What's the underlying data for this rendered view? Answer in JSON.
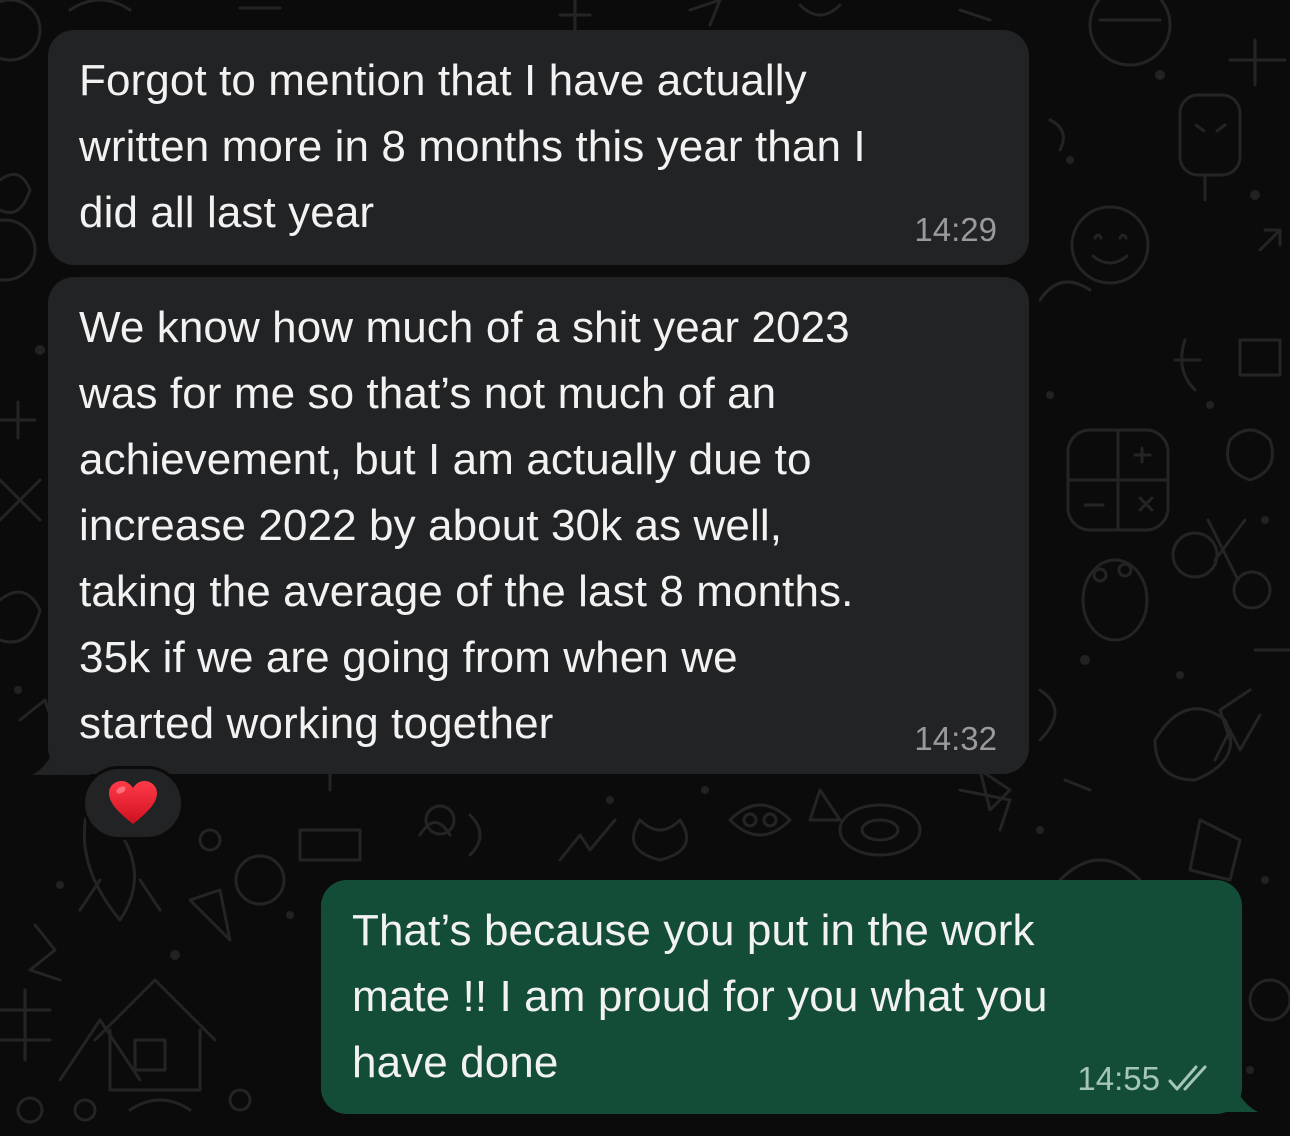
{
  "conversation": {
    "messages": [
      {
        "direction": "incoming",
        "text": "Forgot to mention that I have actually\nwritten more in 8 months this year than I\ndid all last year",
        "time": "14:29"
      },
      {
        "direction": "incoming",
        "text": "We know how much of a shit year 2023\nwas for me so that’s not much of an\nachievement, but I am actually due to\nincrease 2022 by about 30k as well,\ntaking the average of the last 8 months.\n35k if we are going from when we\nstarted working together",
        "time": "14:32",
        "reaction": "heart-emoji"
      },
      {
        "direction": "outgoing",
        "text": "That’s because you put in the work\nmate !! I am proud for you what you\nhave done",
        "time": "14:55",
        "status": "read-double-check"
      }
    ]
  },
  "colors": {
    "background": "#0b0b0b",
    "incoming_bubble": "#222325",
    "outgoing_bubble": "#144d37",
    "text": "#f2f2f2",
    "reaction_heart": "#e3192b"
  }
}
